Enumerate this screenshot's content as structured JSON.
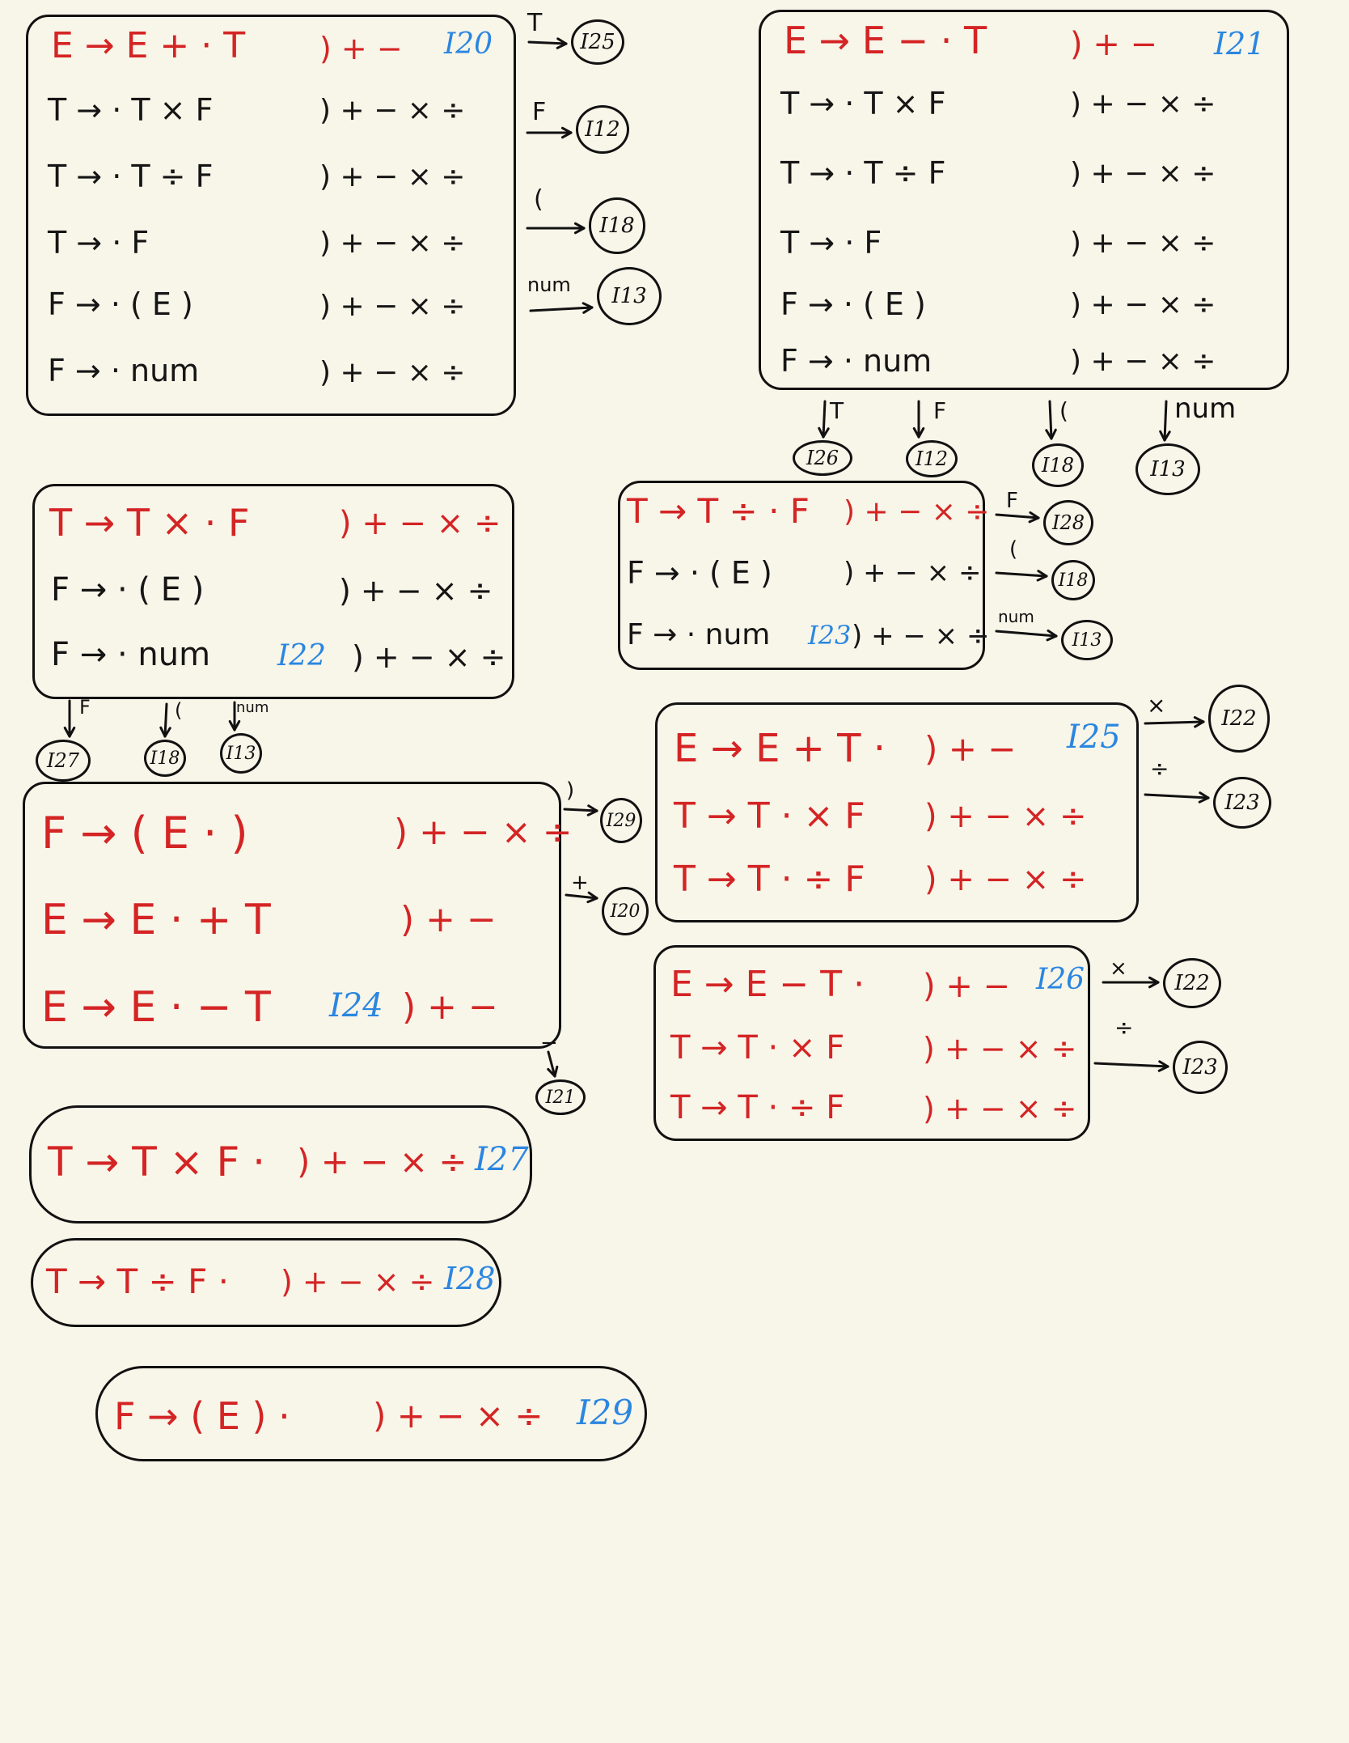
{
  "colors": {
    "background": "#f8f5e9",
    "kernel": "#d42424",
    "closure": "#151515",
    "state_label": "#2a86e0",
    "ink": "#111111"
  },
  "states": [
    {
      "id": "I20",
      "items": [
        {
          "prod": "E → E + · T",
          "la": ") + −",
          "kernel": true
        },
        {
          "prod": "T → · T × F",
          "la": ") + − × ÷",
          "kernel": false
        },
        {
          "prod": "T → · T ÷ F",
          "la": ") + − × ÷",
          "kernel": false
        },
        {
          "prod": "T → · F",
          "la": ") + − × ÷",
          "kernel": false
        },
        {
          "prod": "F → · ( E )",
          "la": ") + − × ÷",
          "kernel": false
        },
        {
          "prod": "F → · num",
          "la": ") + − × ÷",
          "kernel": false
        }
      ],
      "transitions": [
        {
          "symbol": "T",
          "target": "I25"
        },
        {
          "symbol": "F",
          "target": "I12"
        },
        {
          "symbol": "(",
          "target": "I18"
        },
        {
          "symbol": "num",
          "target": "I13"
        }
      ]
    },
    {
      "id": "I21",
      "items": [
        {
          "prod": "E → E − · T",
          "la": ") + −",
          "kernel": true
        },
        {
          "prod": "T → · T × F",
          "la": ") + − × ÷",
          "kernel": false
        },
        {
          "prod": "T → · T ÷ F",
          "la": ") + − × ÷",
          "kernel": false
        },
        {
          "prod": "T → · F",
          "la": ") + − × ÷",
          "kernel": false
        },
        {
          "prod": "F → · ( E )",
          "la": ") + − × ÷",
          "kernel": false
        },
        {
          "prod": "F → · num",
          "la": ") + − × ÷",
          "kernel": false
        }
      ],
      "transitions": [
        {
          "symbol": "T",
          "target": "I26"
        },
        {
          "symbol": "F",
          "target": "I12"
        },
        {
          "symbol": "(",
          "target": "I18"
        },
        {
          "symbol": "num",
          "target": "I13"
        }
      ]
    },
    {
      "id": "I22",
      "items": [
        {
          "prod": "T → T × · F",
          "la": ") + − × ÷",
          "kernel": true
        },
        {
          "prod": "F → · ( E )",
          "la": ") + − × ÷",
          "kernel": false
        },
        {
          "prod": "F → · num",
          "la": ") + − × ÷",
          "kernel": false
        }
      ],
      "transitions": [
        {
          "symbol": "F",
          "target": "I27"
        },
        {
          "symbol": "(",
          "target": "I18"
        },
        {
          "symbol": "num",
          "target": "I13"
        }
      ]
    },
    {
      "id": "I23",
      "items": [
        {
          "prod": "T → T ÷ · F",
          "la": ") + − × ÷",
          "kernel": true
        },
        {
          "prod": "F → · ( E )",
          "la": ") + − × ÷",
          "kernel": false
        },
        {
          "prod": "F → · num",
          "la": ") + − × ÷",
          "kernel": false
        }
      ],
      "transitions": [
        {
          "symbol": "F",
          "target": "I28"
        },
        {
          "symbol": "(",
          "target": "I18"
        },
        {
          "symbol": "num",
          "target": "I13"
        }
      ]
    },
    {
      "id": "I24",
      "items": [
        {
          "prod": "F → ( E · )",
          "la": ") + − × ÷",
          "kernel": true
        },
        {
          "prod": "E → E · + T",
          "la": ") + −",
          "kernel": true
        },
        {
          "prod": "E → E · − T",
          "la": ") + −",
          "kernel": true
        }
      ],
      "transitions": [
        {
          "symbol": ")",
          "target": "I29"
        },
        {
          "symbol": "+",
          "target": "I20"
        },
        {
          "symbol": "−",
          "target": "I21"
        }
      ]
    },
    {
      "id": "I25",
      "items": [
        {
          "prod": "E → E + T ·",
          "la": ") + −",
          "kernel": true
        },
        {
          "prod": "T → T · × F",
          "la": ") + − × ÷",
          "kernel": true
        },
        {
          "prod": "T → T · ÷ F",
          "la": ") + − × ÷",
          "kernel": true
        }
      ],
      "transitions": [
        {
          "symbol": "×",
          "target": "I22"
        },
        {
          "symbol": "÷",
          "target": "I23"
        }
      ]
    },
    {
      "id": "I26",
      "items": [
        {
          "prod": "E → E − T ·",
          "la": ") + −",
          "kernel": true
        },
        {
          "prod": "T → T · × F",
          "la": ") + − × ÷",
          "kernel": true
        },
        {
          "prod": "T → T · ÷ F",
          "la": ") + − × ÷",
          "kernel": true
        }
      ],
      "transitions": [
        {
          "symbol": "×",
          "target": "I22"
        },
        {
          "symbol": "÷",
          "target": "I23"
        }
      ]
    },
    {
      "id": "I27",
      "items": [
        {
          "prod": "T → T × F ·",
          "la": ") + − × ÷",
          "kernel": true
        }
      ],
      "transitions": []
    },
    {
      "id": "I28",
      "items": [
        {
          "prod": "T → T ÷ F ·",
          "la": ") + − × ÷",
          "kernel": true
        }
      ],
      "transitions": []
    },
    {
      "id": "I29",
      "items": [
        {
          "prod": "F → ( E ) ·",
          "la": ") + − × ÷",
          "kernel": true
        }
      ],
      "transitions": []
    }
  ]
}
